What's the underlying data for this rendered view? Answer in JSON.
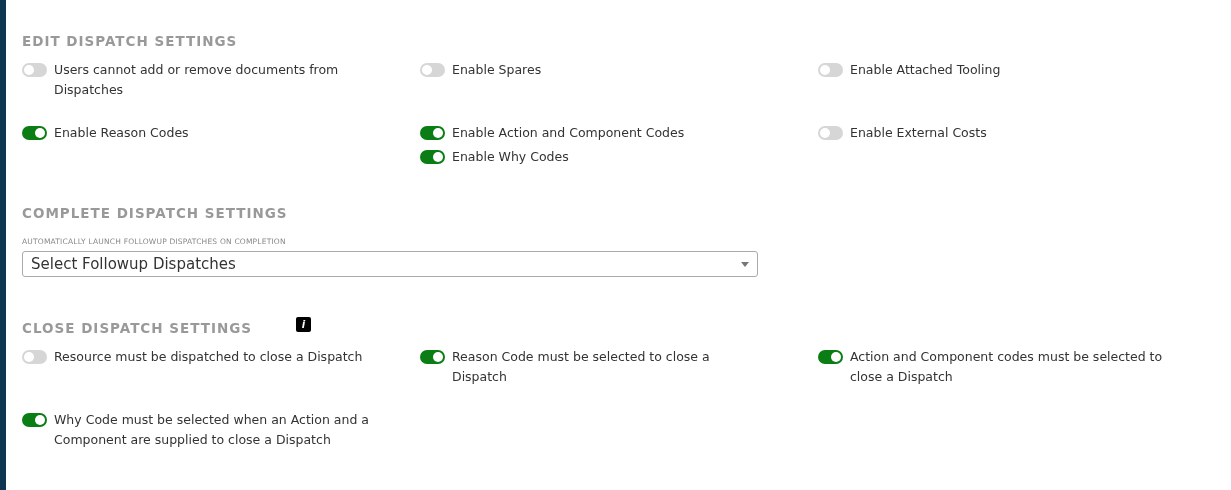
{
  "edit_settings": {
    "title": "EDIT DISPATCH SETTINGS",
    "cells": [
      [
        {
          "label": "Users cannot add or remove documents from Dispatches",
          "on": false
        }
      ],
      [
        {
          "label": "Enable Spares",
          "on": false
        }
      ],
      [
        {
          "label": "Enable Attached Tooling",
          "on": false
        }
      ],
      [
        {
          "label": "Enable Reason Codes",
          "on": true
        }
      ],
      [
        {
          "label": "Enable Action and Component Codes",
          "on": true
        },
        {
          "label": "Enable Why Codes",
          "on": true
        }
      ],
      [
        {
          "label": "Enable External Costs",
          "on": false
        }
      ]
    ]
  },
  "complete_settings": {
    "title": "COMPLETE DISPATCH SETTINGS",
    "field_label": "AUTOMATICALLY LAUNCH FOLLOWUP DISPATCHES ON COMPLETION",
    "dropdown": {
      "placeholder": "Select Followup Dispatches"
    }
  },
  "close_settings": {
    "title": "CLOSE DISPATCH SETTINGS",
    "info": "i",
    "cells": [
      [
        {
          "label": "Resource must be dispatched to close a Dispatch",
          "on": false
        }
      ],
      [
        {
          "label": "Reason Code must be selected to close a Dispatch",
          "on": true
        }
      ],
      [
        {
          "label": "Action and Component codes must be selected to close a Dispatch",
          "on": true
        }
      ],
      [
        {
          "label": "Why Code must be selected when an Action and a Component are supplied to close a Dispatch",
          "on": true
        }
      ]
    ]
  }
}
